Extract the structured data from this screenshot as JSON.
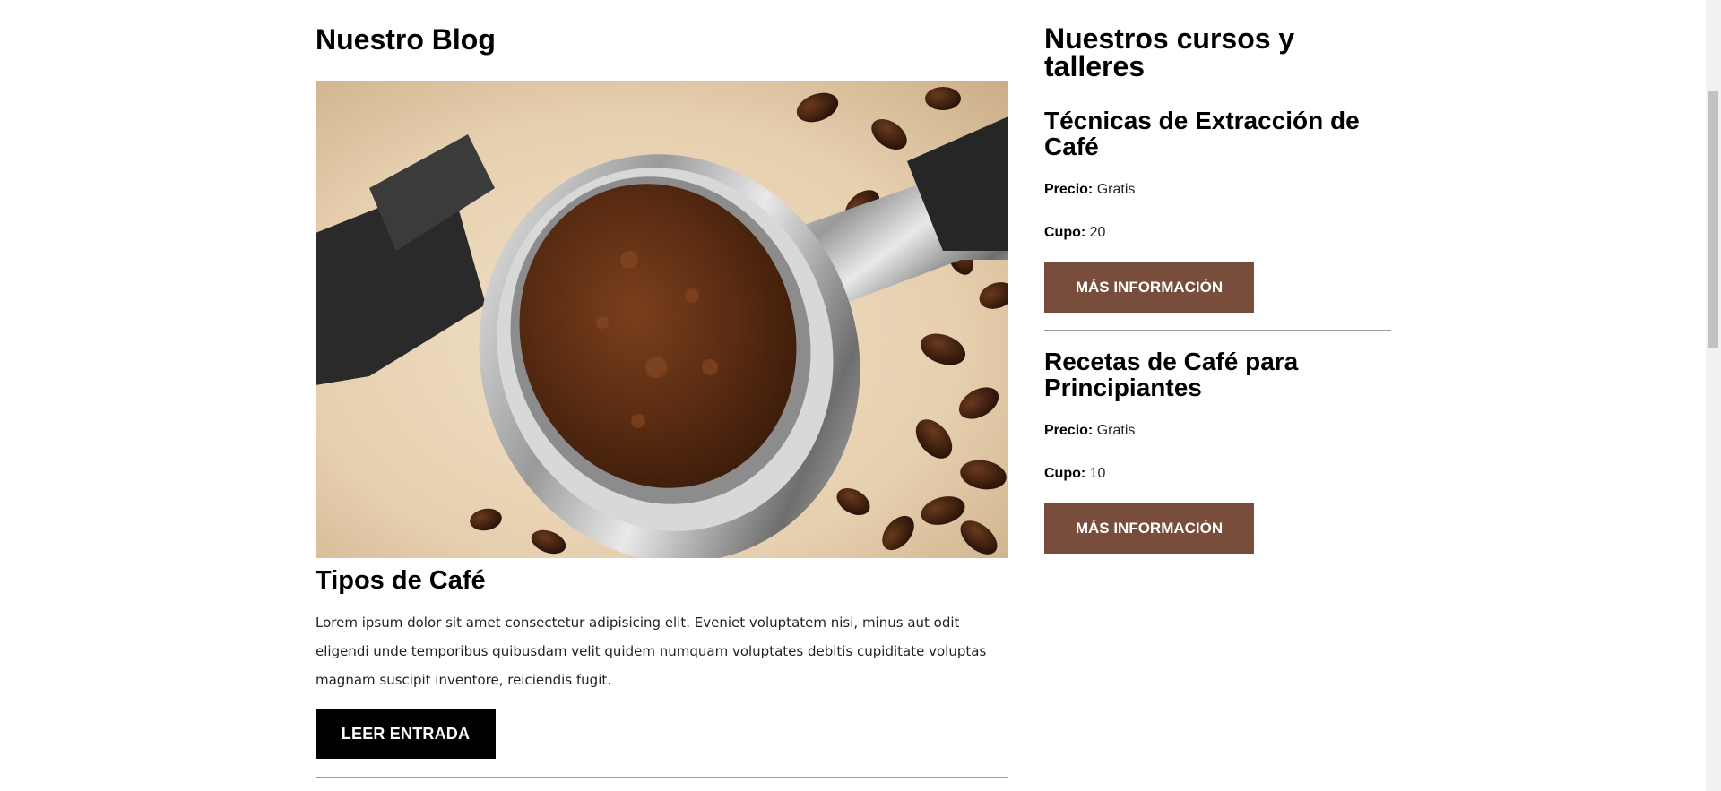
{
  "blog": {
    "title": "Nuestro Blog",
    "image_alt": "portafiltro con café molido y granos de café",
    "entry": {
      "title": "Tipos de Café",
      "text": "Lorem ipsum dolor sit amet consectetur adipisicing elit. Eveniet voluptatem nisi, minus aut odit eligendi unde temporibus quibusdam velit quidem numquam voluptates debitis cupiditate voluptas magnam suscipit inventore, reiciendis fugit.",
      "button_label": "LEER ENTRADA"
    }
  },
  "courses": {
    "title": "Nuestros cursos y talleres",
    "items": [
      {
        "title": "Técnicas de Extracción de Café",
        "price_label": "Precio:",
        "price": "Gratis",
        "quota_label": "Cupo:",
        "quota": "20",
        "button_label": "MÁS INFORMACIÓN"
      },
      {
        "title": "Recetas de Café para Principiantes",
        "price_label": "Precio:",
        "price": "Gratis",
        "quota_label": "Cupo:",
        "quota": "10",
        "button_label": "MÁS INFORMACIÓN"
      }
    ]
  },
  "colors": {
    "accent_brown": "#784d3c",
    "button_black": "#000000",
    "divider": "#9a9a9a"
  }
}
